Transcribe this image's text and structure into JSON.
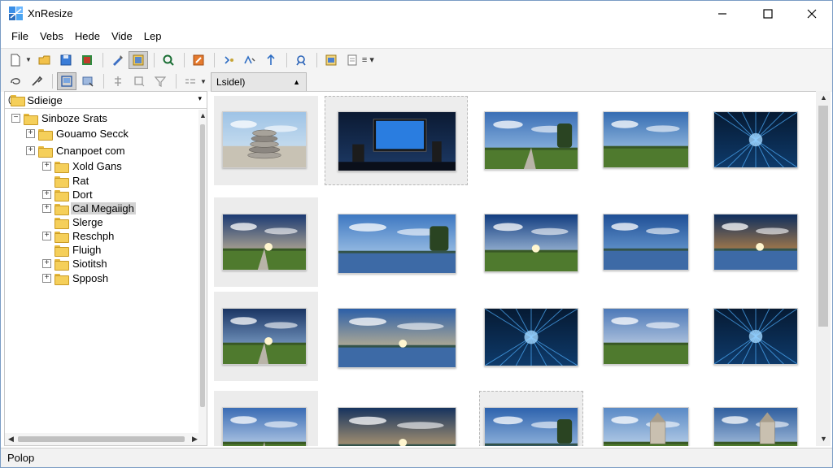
{
  "window": {
    "title": "XnResize"
  },
  "menu": [
    "File",
    "Vebs",
    "Hede",
    "Vide",
    "Lep"
  ],
  "tab": {
    "label": "Lsidel)"
  },
  "folders": {
    "header": "Sdieige",
    "items": [
      {
        "label": "Sinboze Srats",
        "level": 0,
        "expander": "⊟"
      },
      {
        "label": "Gouamo Secck",
        "level": 1,
        "expander": "⊞"
      },
      {
        "label": "Cnanpoet com",
        "level": 1,
        "expander": "⊞"
      },
      {
        "label": "Xold Gans",
        "level": 2,
        "expander": "⊞"
      },
      {
        "label": "Rat",
        "level": 2,
        "expander": ""
      },
      {
        "label": "Dort",
        "level": 2,
        "expander": "⊞"
      },
      {
        "label": "Cal Megaiigh",
        "level": 2,
        "expander": "⊞",
        "selected": true
      },
      {
        "label": "Slerge",
        "level": 2,
        "expander": ""
      },
      {
        "label": "Reschph",
        "level": 2,
        "expander": "⊞"
      },
      {
        "label": "Fluigh",
        "level": 2,
        "expander": ""
      },
      {
        "label": "Siotitsh",
        "level": 2,
        "expander": "⊞"
      },
      {
        "label": "Spposh",
        "level": 2,
        "expander": "⊞"
      }
    ]
  },
  "thumbnails": [
    {
      "scene": "stones"
    },
    {
      "scene": "monitor"
    },
    {
      "scene": "road"
    },
    {
      "scene": "river"
    },
    {
      "scene": "tunnel"
    },
    {
      "scene": "sunset-field"
    },
    {
      "scene": "pier"
    },
    {
      "scene": "sunburst"
    },
    {
      "scene": "lake"
    },
    {
      "scene": "bridge-blue"
    },
    {
      "scene": "field-light"
    },
    {
      "scene": "beach"
    },
    {
      "scene": "tunnel"
    },
    {
      "scene": "field-sky"
    },
    {
      "scene": "tunnel"
    },
    {
      "scene": "cloud-road"
    },
    {
      "scene": "lake-sun"
    },
    {
      "scene": "tree-lake"
    },
    {
      "scene": "castle"
    },
    {
      "scene": "tower"
    }
  ],
  "status": {
    "text": "Polop"
  },
  "colors": {
    "accent": "#7a9cc4",
    "selection": "#d3d3d3",
    "folder": "#f5cf5a"
  }
}
